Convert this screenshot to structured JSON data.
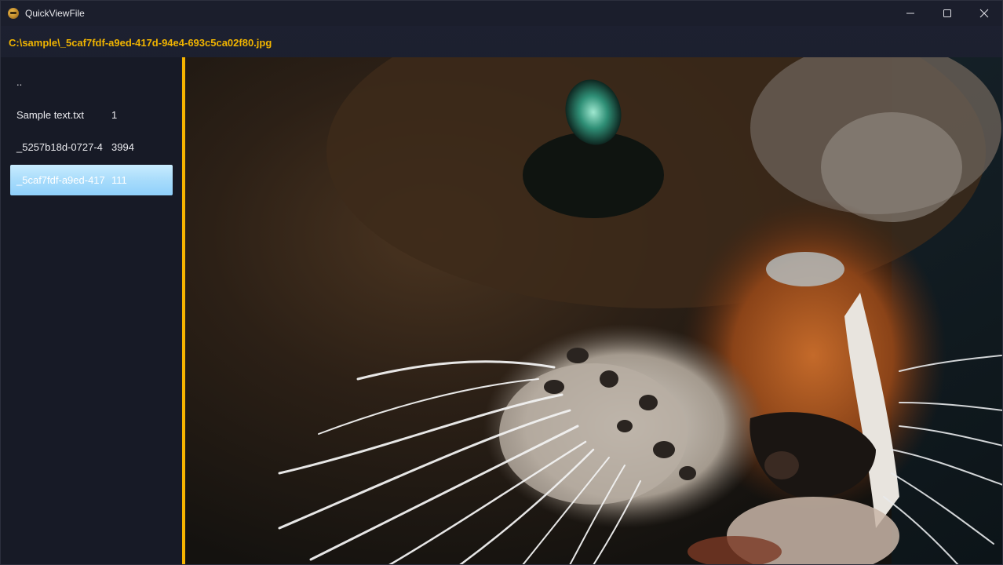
{
  "window": {
    "title": "QuickViewFile",
    "icon": "app-icon"
  },
  "caption": {
    "minimize_icon": "minimize-icon",
    "maximize_icon": "maximize-icon",
    "close_icon": "close-icon"
  },
  "path": {
    "current": "C:\\sample\\_5caf7fdf-a9ed-417d-94e4-693c5ca02f80.jpg"
  },
  "files": [
    {
      "name": "..",
      "size": ""
    },
    {
      "name": "Sample text.txt",
      "size": "1"
    },
    {
      "name": "_5257b18d-0727-4",
      "size": "3994"
    },
    {
      "name": "_5caf7fdf-a9ed-417",
      "size": "111"
    }
  ],
  "selected_index": 3,
  "colors": {
    "accent": "#f5b300",
    "path_text": "#f0b400",
    "selection": "#a8dcfb",
    "background": "#171a26"
  },
  "preview": {
    "content": "cat close-up photo"
  }
}
